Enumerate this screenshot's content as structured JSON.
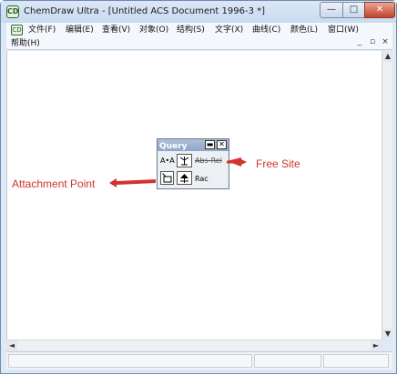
{
  "window": {
    "app_icon_glyph": "CD",
    "title": "ChemDraw Ultra - [Untitled ACS Document 1996-3 *]",
    "controls": {
      "minimize": "—",
      "maximize": "□",
      "close": "✕"
    }
  },
  "menubar": {
    "doc_icon_glyph": "CD",
    "items": [
      "文件(F)",
      "编辑(E)",
      "查看(V)",
      "对象(O)",
      "结构(S)",
      "文字(X)",
      "曲线(C)",
      "颜色(L)",
      "窗口(W)",
      "帮助(H)"
    ],
    "mdi_controls": {
      "minimize": "_",
      "restore": "▫",
      "close": "×"
    }
  },
  "palette": {
    "title": "Query",
    "minimize_glyph": "▬",
    "close_glyph": "✕",
    "tools": {
      "atom_atom_label": "A•A",
      "abs_rel_label": "Abs-Rel",
      "rac_label": "Rac"
    }
  },
  "annotations": {
    "free_site": "Free Site",
    "attachment_point": "Attachment Point",
    "arrow_color": "#d0342c"
  },
  "scrollbars": {
    "up": "▲",
    "down": "▼",
    "left": "◄",
    "right": "►"
  }
}
